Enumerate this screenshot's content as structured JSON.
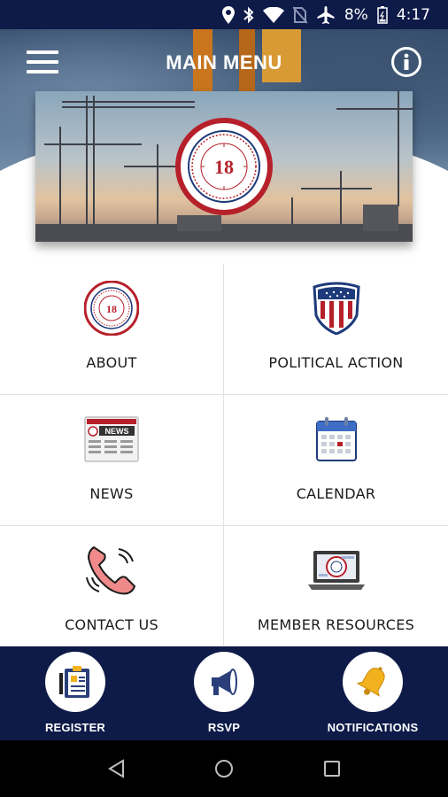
{
  "status_bar": {
    "battery": "8%",
    "time": "4:17",
    "icons": [
      "location-icon",
      "bluetooth-icon",
      "wifi-icon",
      "no-sim-icon",
      "airplane-icon",
      "battery-icon"
    ]
  },
  "header": {
    "title": "MAIN MENU",
    "menu_icon": "hamburger-menu-icon",
    "info_icon": "info-icon"
  },
  "banner": {
    "logo_number": "18"
  },
  "menu": {
    "items": [
      {
        "label": "ABOUT",
        "icon": "union-seal-icon"
      },
      {
        "label": "POLITICAL ACTION",
        "icon": "shield-flag-icon"
      },
      {
        "label": "NEWS",
        "icon": "newspaper-icon"
      },
      {
        "label": "CALENDAR",
        "icon": "calendar-icon"
      },
      {
        "label": "CONTACT US",
        "icon": "phone-icon"
      },
      {
        "label": "MEMBER RESOURCES",
        "icon": "laptop-icon"
      }
    ],
    "news_icon_text": "NEWS"
  },
  "bottom_nav": {
    "items": [
      {
        "label": "REGISTER",
        "icon": "clipboard-icon"
      },
      {
        "label": "RSVP",
        "icon": "megaphone-icon"
      },
      {
        "label": "NOTIFICATIONS",
        "icon": "bell-icon"
      }
    ]
  },
  "colors": {
    "navy": "#0e1a48",
    "seal_red": "#b6202b",
    "seal_blue": "#1d3a7a",
    "bell_gold": "#f2b21e"
  }
}
